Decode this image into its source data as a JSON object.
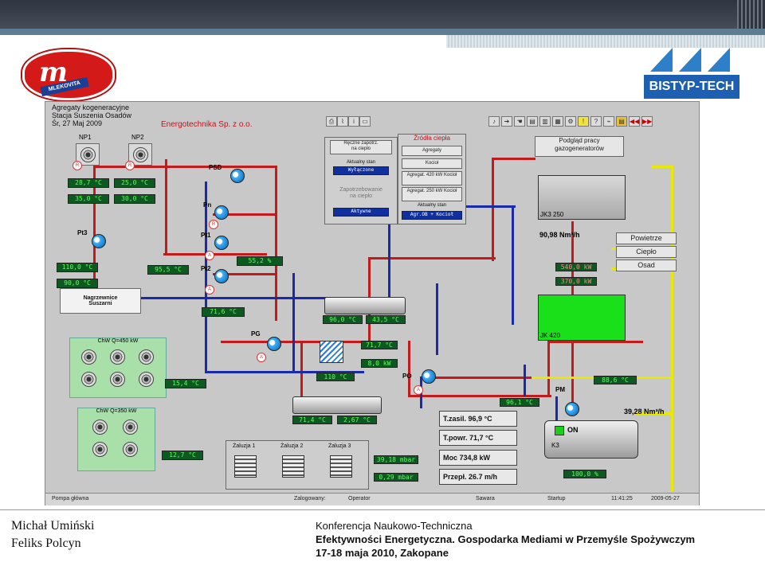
{
  "slide": {
    "company_logo_left": "MLEKOVITA",
    "company_logo_right": "BISTYP-TECH",
    "authors": [
      "Michał Umiński",
      "Feliks Polcyn"
    ],
    "conference": [
      "Konferencja Naukowo-Techniczna",
      "Efektywności Energetyczna. Gospodarka Mediami w Przemyśle Spożywczym",
      "17-18 maja 2010, Zakopane"
    ]
  },
  "scada": {
    "title_lines": [
      "Agregaty kogeneracyjne",
      "Stacja Suszenia Osadów",
      "Śr, 27 Maj 2009"
    ],
    "firm": "Energotechnika Sp. z o.o.",
    "np1": "NP1",
    "np2": "NP2",
    "psd": "PSD",
    "pn": "Pn",
    "pt1": "Pt1",
    "pt2": "Pt2",
    "pt3": "Pt3",
    "pg": "PG",
    "po": "PO",
    "pm": "PM",
    "temp_np1": "28,7 °C",
    "temp_np2": "25,0 °C",
    "temp_max1": "35,0 °C",
    "temp_max2": "30,0 °C",
    "temp_left1": "110,0 °C",
    "temp_left2": "90,0 °C",
    "nagrzewnice": [
      "Nagrzewnice",
      "Suszarni"
    ],
    "chw1": "ChW Q=450 kW",
    "chw2": "ChW Q=350 kW",
    "temp_chw1": "15,4 °C",
    "temp_chw2": "12,7 °C",
    "temp_mid1": "95,5 °C",
    "temp_mid2": "55,2 %",
    "temp_mid3": "71,6 °C",
    "temp_k2_in": "96,0 °C",
    "temp_k2_out": "43,5 °C",
    "temp_k3_in": "71,4 °C",
    "temp_k3_out": "2,67 °C",
    "temp_pw1": "71,7 °C",
    "temp_pw2": "8,0 kW",
    "temp_pw3": "110 °C",
    "temp_o": "96,1 °C",
    "temp_kotla": "88,6 °C",
    "zaluzja": [
      "Żaluzja 1",
      "Żaluzja 2",
      "Żaluzja 3"
    ],
    "press1": "39,18 mbar",
    "press2": "0,29 mbar",
    "heat_panel": {
      "btn_top": [
        "Ręczne zapotrz.",
        "na ciepło"
      ],
      "status_label": "Aktualny stan",
      "status_val": "Wyłączone",
      "zapotrz": [
        "Zapotrzebowanie",
        "na ciepło"
      ],
      "zapotrz_val": "Aktywne"
    },
    "source_panel": {
      "title": "Źródła ciepła",
      "items": [
        "Agregaty",
        "Kocioł",
        "Agregat. 420 kW Kocioł",
        "Agregat. 250 kW Kocioł"
      ],
      "state_label": "Aktualny stan",
      "state_val": "Agr.OB + Kocioł"
    },
    "podglad": [
      "Podgląd pracy",
      "gazogeneratorów"
    ],
    "jk250": "JK3 250",
    "jk420": "JK 420",
    "flow1": "90,98 Nm³/h",
    "flow2": "39,28 Nm³/h",
    "moc_auto": "540,0 kW",
    "moc_real": "370,0 kW",
    "side_btns": [
      "Powietrze",
      "Ciepło",
      "Osad"
    ],
    "readouts": [
      {
        "label": "T.zasil.",
        "value": "96,9 °C"
      },
      {
        "label": "T.powr.",
        "value": "71,7 °C"
      },
      {
        "label": "Moc",
        "value": "734,8 kW"
      },
      {
        "label": "Przepł.",
        "value": "26.7 m/h"
      }
    ],
    "k3_on": "ON",
    "k3_label": "K3",
    "k3_moc": "100,0 %",
    "status_bar": [
      "Pompa główna",
      "Zalogowany:",
      "Operator",
      "Sawara",
      "Startup",
      "11:41:25",
      "2009-05-27"
    ]
  },
  "colors": {
    "pipe_hot": "#c31b1b",
    "pipe_cold": "#1a2aa8",
    "gas": "#e8e800",
    "tank_420": "#19e019"
  }
}
